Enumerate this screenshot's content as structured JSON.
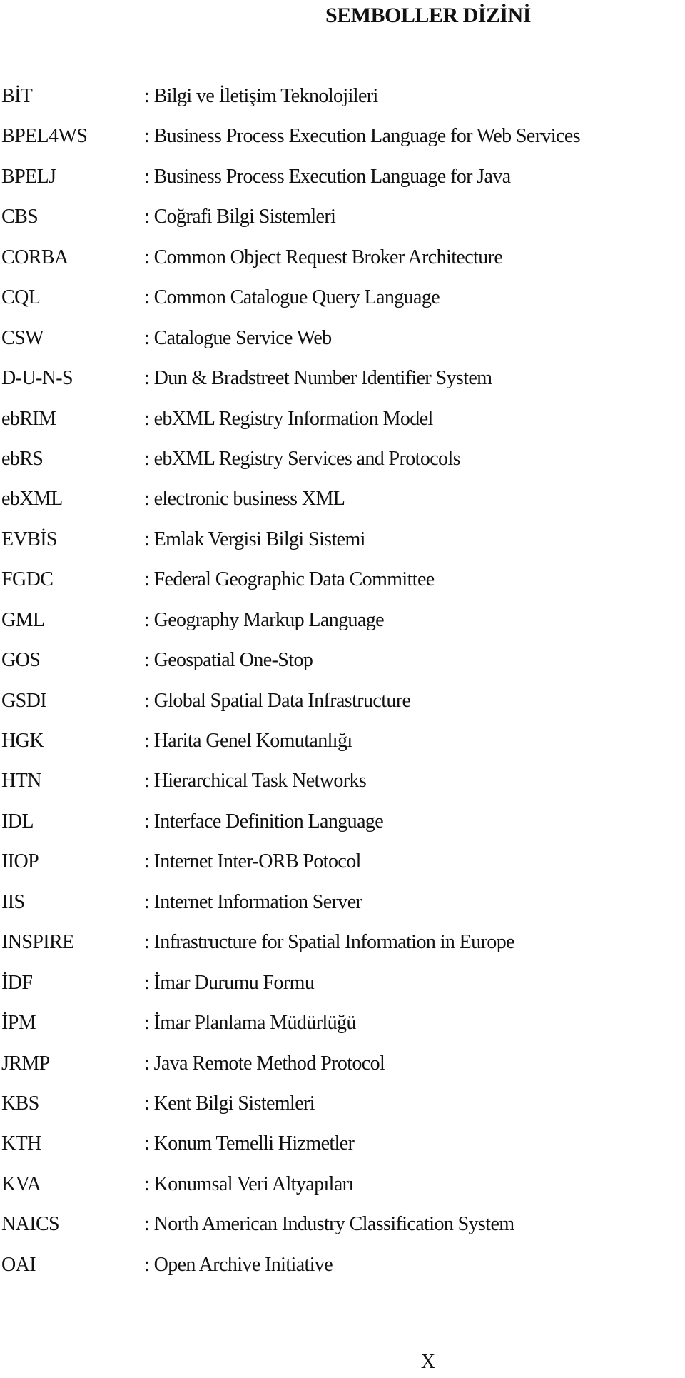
{
  "page": {
    "title": "SEMBOLLER DİZİNİ",
    "page_number": "X"
  },
  "entries": [
    {
      "term": "BİT",
      "definition": ": Bilgi ve İletişim Teknolojileri"
    },
    {
      "term": "BPEL4WS",
      "definition": ": Business Process Execution Language for Web Services"
    },
    {
      "term": "BPELJ",
      "definition": ": Business Process Execution Language for Java"
    },
    {
      "term": "CBS",
      "definition": ": Coğrafi Bilgi Sistemleri"
    },
    {
      "term": "CORBA",
      "definition": ": Common Object Request Broker Architecture"
    },
    {
      "term": "CQL",
      "definition": ": Common Catalogue Query Language"
    },
    {
      "term": "CSW",
      "definition": ": Catalogue Service Web"
    },
    {
      "term": "D-U-N-S",
      "definition": ": Dun & Bradstreet Number Identifier System"
    },
    {
      "term": "ebRIM",
      "definition": ": ebXML Registry Information Model"
    },
    {
      "term": "ebRS",
      "definition": ": ebXML Registry Services and Protocols"
    },
    {
      "term": "ebXML",
      "definition": ": electronic business XML"
    },
    {
      "term": "EVBİS",
      "definition": ": Emlak Vergisi Bilgi Sistemi"
    },
    {
      "term": "FGDC",
      "definition": ": Federal Geographic Data Committee"
    },
    {
      "term": "GML",
      "definition": ": Geography Markup Language"
    },
    {
      "term": "GOS",
      "definition": ": Geospatial One-Stop"
    },
    {
      "term": "GSDI",
      "definition": ": Global Spatial Data Infrastructure"
    },
    {
      "term": "HGK",
      "definition": ": Harita Genel Komutanlığı"
    },
    {
      "term": "HTN",
      "definition": ": Hierarchical Task Networks"
    },
    {
      "term": "IDL",
      "definition": ": Interface Definition Language"
    },
    {
      "term": "IIOP",
      "definition": ": Internet Inter-ORB Potocol"
    },
    {
      "term": "IIS",
      "definition": ": Internet Information Server"
    },
    {
      "term": "INSPIRE",
      "definition": ": Infrastructure for Spatial Information in Europe"
    },
    {
      "term": "İDF",
      "definition": ": İmar Durumu Formu"
    },
    {
      "term": "İPM",
      "definition": ": İmar Planlama Müdürlüğü"
    },
    {
      "term": "JRMP",
      "definition": ": Java Remote Method Protocol"
    },
    {
      "term": "KBS",
      "definition": ": Kent Bilgi Sistemleri"
    },
    {
      "term": "KTH",
      "definition": ": Konum Temelli Hizmetler"
    },
    {
      "term": "KVA",
      "definition": ": Konumsal Veri Altyapıları"
    },
    {
      "term": "NAICS",
      "definition": ": North American Industry Classification System"
    },
    {
      "term": "OAI",
      "definition": ": Open Archive Initiative"
    }
  ]
}
